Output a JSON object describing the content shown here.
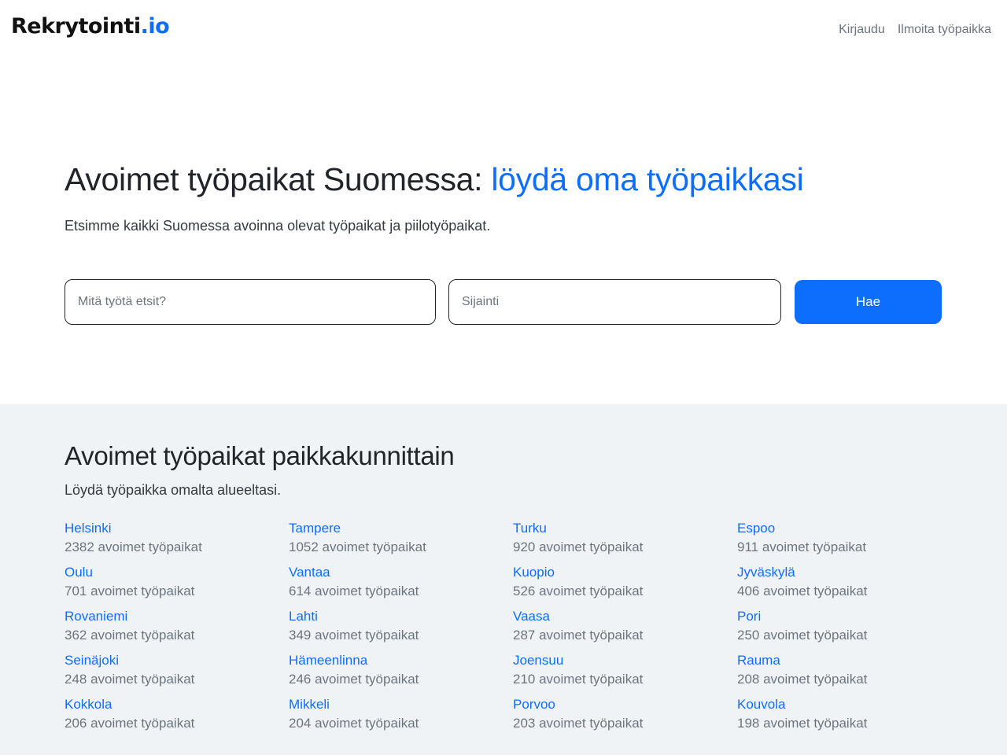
{
  "header": {
    "logo_main": "Rekrytointi",
    "logo_accent": ".io",
    "nav": {
      "login": "Kirjaudu",
      "post_job": "Ilmoita työpaikka"
    }
  },
  "hero": {
    "title_main": "Avoimet työpaikat Suomessa: ",
    "title_accent": "löydä oma työpaikkasi",
    "subtitle": "Etsimme kaikki Suomessa avoinna olevat työpaikat ja piilotyöpaikat."
  },
  "search": {
    "query_placeholder": "Mitä työtä etsit?",
    "query_value": "",
    "location_placeholder": "Sijainti",
    "location_value": "",
    "button_label": "Hae"
  },
  "cities": {
    "title": "Avoimet työpaikat paikkakunnittain",
    "subtitle": "Löydä työpaikka omalta alueeltasi.",
    "items": [
      {
        "name": "Helsinki",
        "count": "2382 avoimet työpaikat"
      },
      {
        "name": "Tampere",
        "count": "1052 avoimet työpaikat"
      },
      {
        "name": "Turku",
        "count": "920 avoimet työpaikat"
      },
      {
        "name": "Espoo",
        "count": "911 avoimet työpaikat"
      },
      {
        "name": "Oulu",
        "count": "701 avoimet työpaikat"
      },
      {
        "name": "Vantaa",
        "count": "614 avoimet työpaikat"
      },
      {
        "name": "Kuopio",
        "count": "526 avoimet työpaikat"
      },
      {
        "name": "Jyväskylä",
        "count": "406 avoimet työpaikat"
      },
      {
        "name": "Rovaniemi",
        "count": "362 avoimet työpaikat"
      },
      {
        "name": "Lahti",
        "count": "349 avoimet työpaikat"
      },
      {
        "name": "Vaasa",
        "count": "287 avoimet työpaikat"
      },
      {
        "name": "Pori",
        "count": "250 avoimet työpaikat"
      },
      {
        "name": "Seinäjoki",
        "count": "248 avoimet työpaikat"
      },
      {
        "name": "Hämeenlinna",
        "count": "246 avoimet työpaikat"
      },
      {
        "name": "Joensuu",
        "count": "210 avoimet työpaikat"
      },
      {
        "name": "Rauma",
        "count": "208 avoimet työpaikat"
      },
      {
        "name": "Kokkola",
        "count": "206 avoimet työpaikat"
      },
      {
        "name": "Mikkeli",
        "count": "204 avoimet työpaikat"
      },
      {
        "name": "Porvoo",
        "count": "203 avoimet työpaikat"
      },
      {
        "name": "Kouvola",
        "count": "198 avoimet työpaikat"
      }
    ]
  },
  "colors": {
    "accent": "#0d6efd",
    "section_bg": "#f0f3f6",
    "muted_text": "#6c757d"
  }
}
